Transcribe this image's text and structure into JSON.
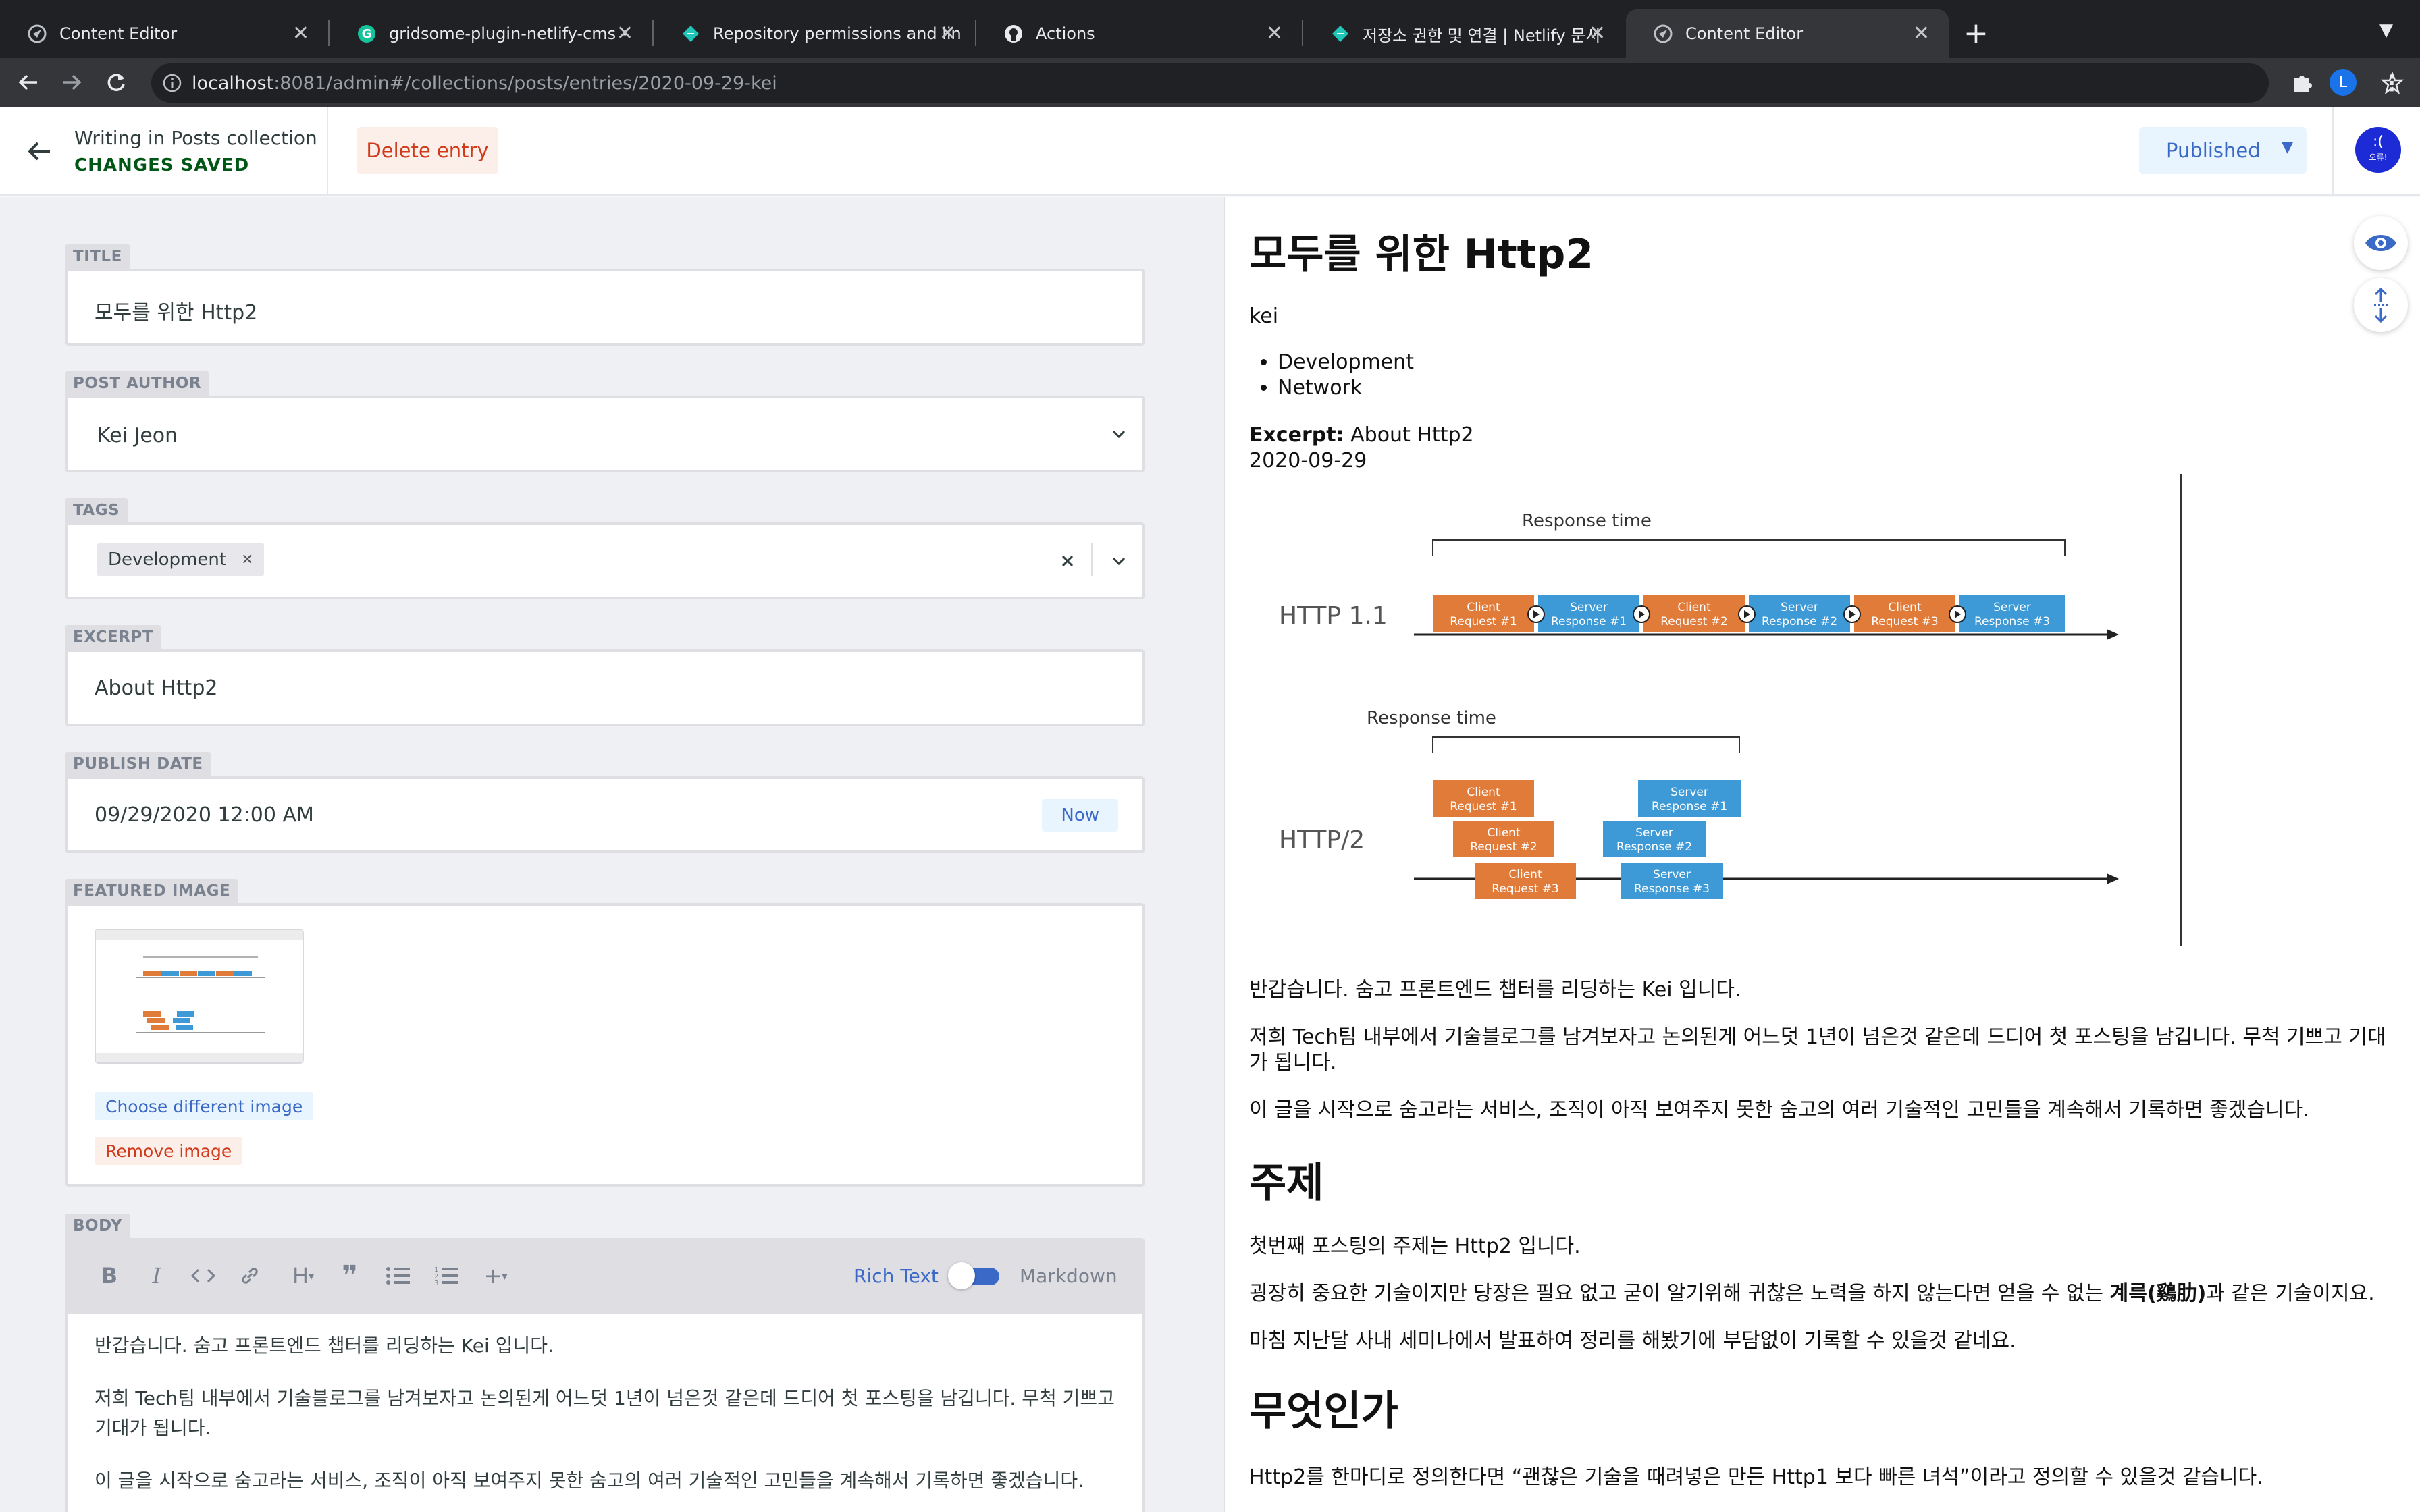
{
  "browser": {
    "tabs": [
      {
        "title": "Content Editor",
        "icon": "netlify-cms-icon"
      },
      {
        "title": "gridsome-plugin-netlify-cms -",
        "icon": "grammarly-icon"
      },
      {
        "title": "Repository permissions and lin",
        "icon": "netlify-icon"
      },
      {
        "title": "Actions",
        "icon": "github-icon"
      },
      {
        "title": "저장소 권한 및 연결 | Netlify 문서",
        "icon": "netlify-icon"
      },
      {
        "title": "Content Editor",
        "icon": "netlify-cms-icon"
      }
    ],
    "url_host": "localhost",
    "url_rest": ":8081/admin#/collections/posts/entries/2020-09-29-kei",
    "profile_initial": "L"
  },
  "cms": {
    "writing_label": "Writing in Posts collection",
    "status": "CHANGES SAVED",
    "delete_label": "Delete entry",
    "publish_label": "Published",
    "avatar_text": ":(",
    "avatar_sub": "오류!"
  },
  "fields": {
    "title": {
      "label": "TITLE",
      "value": "모두를 위한 Http2"
    },
    "author": {
      "label": "POST AUTHOR",
      "value": "Kei Jeon"
    },
    "tags": {
      "label": "TAGS",
      "values": [
        "Development"
      ]
    },
    "excerpt": {
      "label": "EXCERPT",
      "value": "About Http2"
    },
    "date": {
      "label": "PUBLISH DATE",
      "value": "09/29/2020 12:00 AM",
      "now_label": "Now"
    },
    "image": {
      "label": "FEATURED IMAGE",
      "choose_label": "Choose different image",
      "remove_label": "Remove image"
    },
    "body": {
      "label": "BODY",
      "rich_text_label": "Rich Text",
      "markdown_label": "Markdown",
      "paragraphs": [
        "반갑습니다. 숨고 프론트엔드 챕터를 리딩하는 Kei 입니다.",
        "저희 Tech팀 내부에서 기술블로그를 남겨보자고 논의된게 어느덧 1년이 넘은것 같은데 드디어 첫 포스팅을 남깁니다. 무척 기쁘고 기대가 됩니다.",
        "이 글을 시작으로 숨고라는 서비스, 조직이 아직 보여주지 못한 숨고의 여러 기술적인 고민들을 계속해서 기록하면 좋겠습니다."
      ]
    }
  },
  "preview": {
    "title": "모두를 위한 Http2",
    "author": "kei",
    "tags": [
      "Development",
      "Network"
    ],
    "excerpt_label": "Excerpt:",
    "excerpt": "About Http2",
    "date": "2020-09-29",
    "diagram": {
      "response_time": "Response time",
      "http11": "HTTP 1.1",
      "http2": "HTTP/2",
      "c1": "Client",
      "c1b": "Request #1",
      "s1": "Server",
      "s1b": "Response #1",
      "c2": "Client",
      "c2b": "Request #2",
      "s2": "Server",
      "s2b": "Response #2",
      "c3": "Client",
      "c3b": "Request #3",
      "s3": "Server",
      "s3b": "Response #3"
    },
    "p1": "반갑습니다. 숨고 프론트엔드 챕터를 리딩하는 Kei 입니다.",
    "p2": "저희 Tech팀 내부에서 기술블로그를 남겨보자고 논의된게 어느덧 1년이 넘은것 같은데 드디어 첫 포스팅을 남깁니다. 무척 기쁘고 기대가 됩니다.",
    "p3": "이 글을 시작으로 숨고라는 서비스, 조직이 아직 보여주지 못한 숨고의 여러 기술적인 고민들을 계속해서 기록하면 좋겠습니다.",
    "h_topic": "주제",
    "p4": "첫번째 포스팅의 주제는 Http2 입니다.",
    "p5a": "굉장히 중요한 기술이지만 당장은 필요 없고 굳이 알기위해 귀찮은 노력을 하지 않는다면 얻을 수 없는 ",
    "p5b": "계륵(鷄肋)",
    "p5c": "과 같은 기술이지요.",
    "p6": "마침 지난달 사내 세미나에서 발표하여 정리를 해봤기에 부담없이 기록할 수 있을것 같네요.",
    "h_what": "무엇인가",
    "p7": "Http2를 한마디로 정의한다면 “괜찮은 기술을 때려넣은 만든 Http1 보다 빠른 녀석”이라고 정의할 수 있을것 같습니다."
  },
  "colors": {
    "client": "#e07b39",
    "server": "#3d9ad6",
    "accent": "#3a69c7",
    "saved": "#005614",
    "danger": "#d03a1a"
  }
}
